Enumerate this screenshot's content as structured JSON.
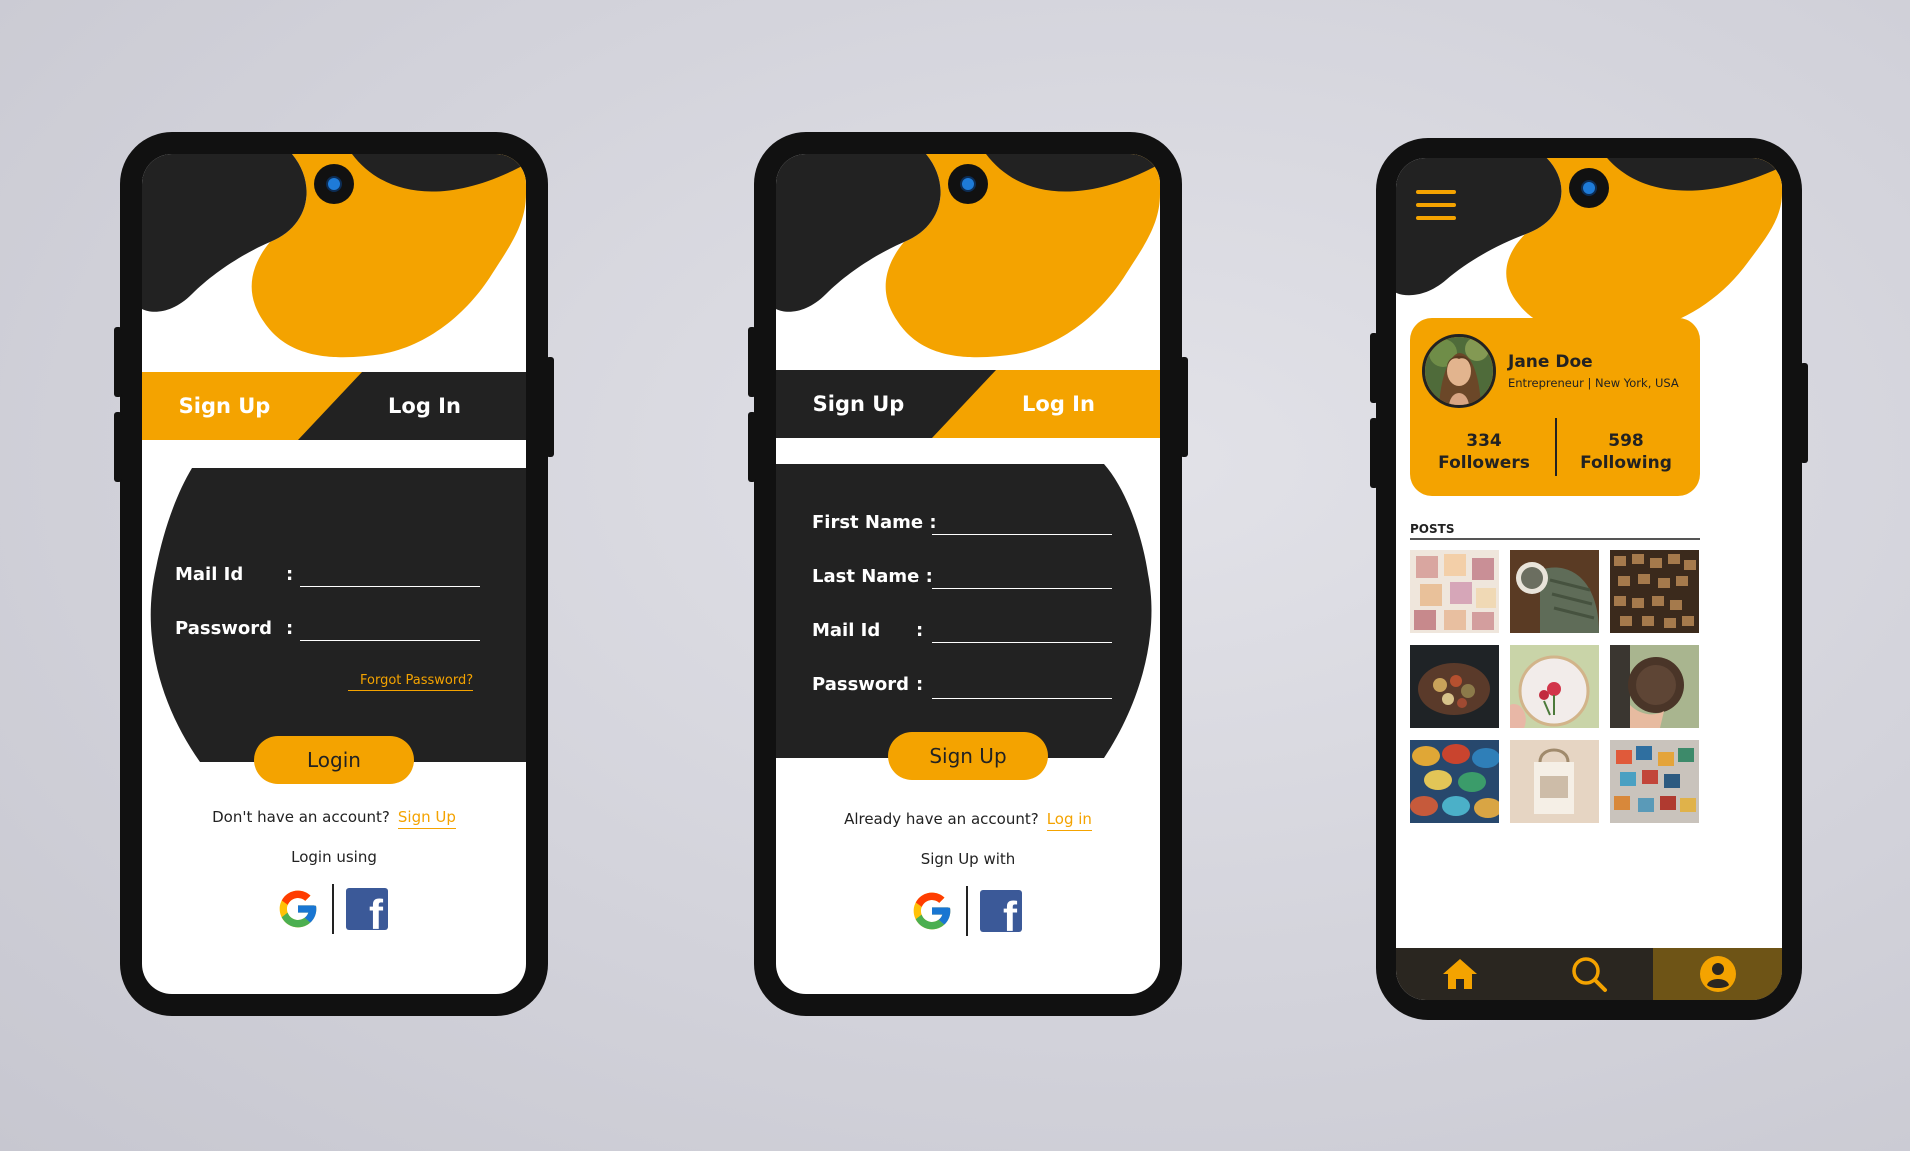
{
  "colors": {
    "accent": "#f4a300",
    "dark": "#222222",
    "white": "#ffffff",
    "facebook": "#3b5998",
    "camera": "#1e7bd8"
  },
  "login_screen": {
    "tabs": {
      "signup": "Sign Up",
      "login": "Log In",
      "active": "login"
    },
    "fields": [
      {
        "label": "Mail Id",
        "value": ""
      },
      {
        "label": "Password",
        "value": ""
      }
    ],
    "forgot": "Forgot Password?",
    "button": "Login",
    "no_account": "Don't have an account?",
    "signup_link": "Sign Up",
    "login_using": "Login using",
    "icons": [
      "google-icon",
      "facebook-icon"
    ]
  },
  "signup_screen": {
    "tabs": {
      "signup": "Sign Up",
      "login": "Log In",
      "active": "signup"
    },
    "fields": [
      {
        "label": "First Name :",
        "value": ""
      },
      {
        "label": "Last Name :",
        "value": ""
      },
      {
        "label": "Mail Id",
        "value": ""
      },
      {
        "label": "Password",
        "value": ""
      }
    ],
    "button": "Sign Up",
    "have_account": "Already have an account?",
    "login_link": "Log in",
    "signup_with": "Sign Up with",
    "icons": [
      "google-icon",
      "facebook-icon"
    ]
  },
  "profile_screen": {
    "name": "Jane Doe",
    "subtitle": "Entrepreneur | New York, USA",
    "followers": {
      "count": "334",
      "label": "Followers"
    },
    "following": {
      "count": "598",
      "label": "Following"
    },
    "posts_title": "POSTS",
    "nav": [
      "home-icon",
      "search-icon",
      "profile-icon"
    ],
    "active_nav": "profile-icon"
  }
}
